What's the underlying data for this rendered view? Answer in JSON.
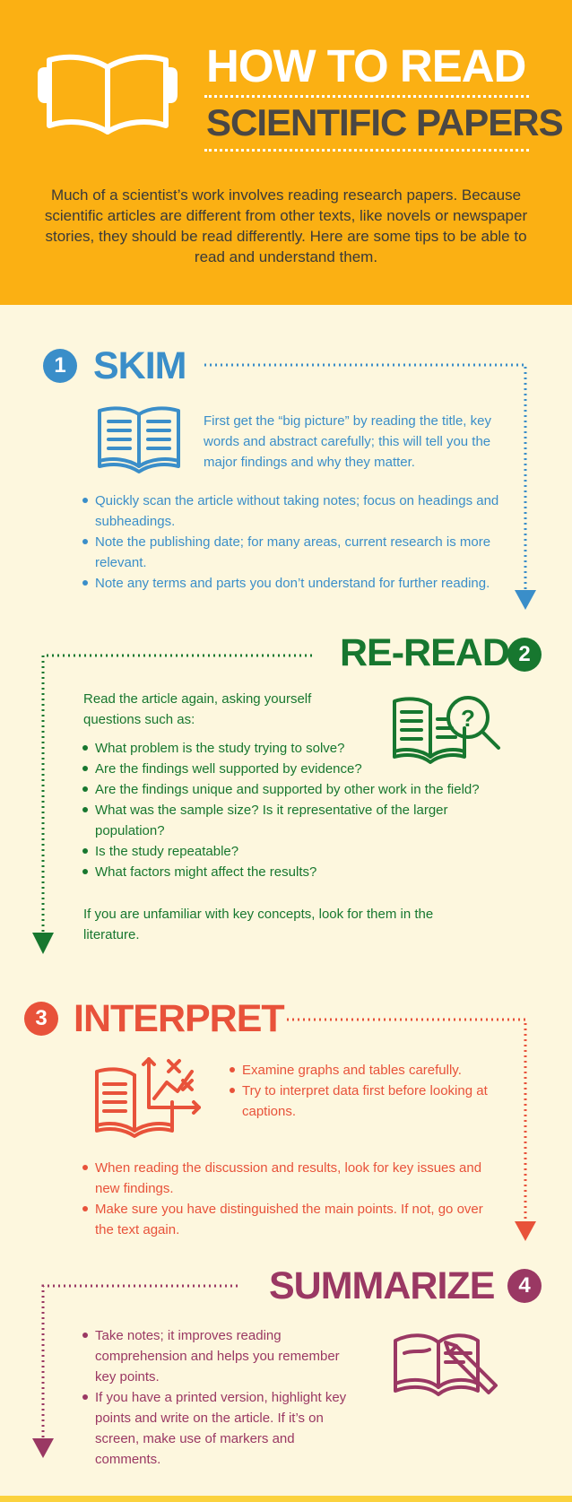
{
  "header": {
    "title_line1": "HOW TO READ",
    "title_line2": "SCIENTIFIC PAPERS",
    "intro": "Much of a scientist’s work involves reading research papers. Because scientific articles are different from other texts, like novels or newspaper stories, they should be read differently. Here are some tips to be able to read and understand them.",
    "icon": "open-book-icon"
  },
  "colors": {
    "header_bg": "#fbb013",
    "page_bg": "#fdf7de",
    "skim": "#3a8ec9",
    "reread": "#17772f",
    "interpret": "#e8523a",
    "summarize": "#9a3863"
  },
  "sections": {
    "skim": {
      "number": "1",
      "title": "SKIM",
      "icon": "book-icon",
      "intro": "First get the “big picture” by reading the title, key words and abstract carefully; this will tell you the major findings and why they matter.",
      "bullets": [
        "Quickly scan the article without taking notes; focus on headings and subheadings.",
        "Note the publishing date; for many areas, current research is more relevant.",
        "Note any terms and parts you don’t understand for further reading."
      ]
    },
    "reread": {
      "number": "2",
      "title": "RE-READ",
      "icon": "book-magnifier-question-icon",
      "intro": "Read the article again, asking yourself questions such as:",
      "bullets": [
        "What problem is the study trying to solve?",
        "Are the findings well supported by evidence?",
        "Are the findings unique and supported by other work in the field?",
        "What was the sample size? Is it representative of the larger population?",
        "Is the study repeatable?",
        "What factors might affect the results?"
      ],
      "outro": "If you are unfamiliar with key concepts, look for them in the literature."
    },
    "interpret": {
      "number": "3",
      "title": "INTERPRET",
      "icon": "book-graph-icon",
      "bullets_top": [
        "Examine graphs and tables carefully.",
        "Try to interpret data first before looking at captions."
      ],
      "bullets": [
        "When reading the discussion and results, look for key issues and new findings.",
        "Make sure you have distinguished the main points. If not, go over the text again."
      ]
    },
    "summarize": {
      "number": "4",
      "title": "SUMMARIZE",
      "icon": "book-pencil-icon",
      "bullets": [
        "Take notes; it improves reading comprehension and helps you remember key points.",
        "If you have a printed version, highlight key points and write on the article. If it’s on screen, make use of markers and comments."
      ]
    }
  }
}
